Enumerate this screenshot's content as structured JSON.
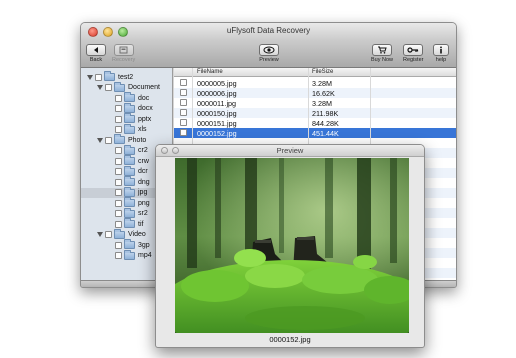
{
  "window": {
    "title": "uFlysoft Data Recovery"
  },
  "toolbar": {
    "back_label": "Back",
    "recovery_label": "Recovery",
    "preview_label": "Preview",
    "buy_label": "Buy Now",
    "register_label": "Register",
    "help_label": "help"
  },
  "sidebar": {
    "items": [
      {
        "label": "test2",
        "level": 0,
        "expanded": true
      },
      {
        "label": "Document",
        "level": 1,
        "expanded": true
      },
      {
        "label": "doc",
        "level": 2
      },
      {
        "label": "docx",
        "level": 2
      },
      {
        "label": "pptx",
        "level": 2
      },
      {
        "label": "xls",
        "level": 2
      },
      {
        "label": "Photo",
        "level": 1,
        "expanded": true
      },
      {
        "label": "cr2",
        "level": 2
      },
      {
        "label": "crw",
        "level": 2
      },
      {
        "label": "dcr",
        "level": 2
      },
      {
        "label": "dng",
        "level": 2
      },
      {
        "label": "jpg",
        "level": 2,
        "selected": true
      },
      {
        "label": "png",
        "level": 2
      },
      {
        "label": "sr2",
        "level": 2
      },
      {
        "label": "tif",
        "level": 2
      },
      {
        "label": "Video",
        "level": 1,
        "expanded": true
      },
      {
        "label": "3gp",
        "level": 2
      },
      {
        "label": "mp4",
        "level": 2
      }
    ]
  },
  "filelist": {
    "columns": {
      "name": "FileName",
      "size": "FileSize"
    },
    "rows": [
      {
        "name": "0000005.jpg",
        "size": "3.28M"
      },
      {
        "name": "0000006.jpg",
        "size": "16.62K"
      },
      {
        "name": "0000011.jpg",
        "size": "3.28M"
      },
      {
        "name": "0000150.jpg",
        "size": "211.98K"
      },
      {
        "name": "0000151.jpg",
        "size": "844.28K"
      },
      {
        "name": "0000152.jpg",
        "size": "451.44K",
        "selected": true
      }
    ]
  },
  "preview": {
    "title": "Preview",
    "filename": "0000152.jpg"
  },
  "colors": {
    "selection": "#3875d7",
    "sidebar_bg": "#dde4ec",
    "row_alt": "#edf3fb"
  }
}
